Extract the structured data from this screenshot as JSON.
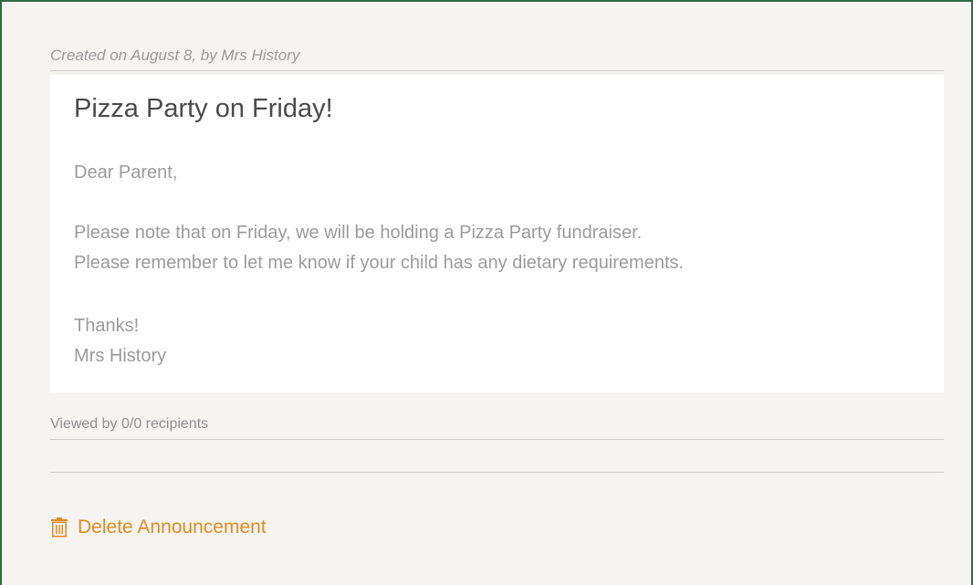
{
  "announcement": {
    "meta": "Created on August 8, by Mrs History",
    "title": "Pizza Party on Friday!",
    "body": {
      "greeting": "Dear Parent,",
      "line1": "Please note that on Friday, we will be holding a Pizza Party fundraiser.",
      "line2": "Please remember to let me know if your child has any dietary requirements.",
      "closing": "Thanks!",
      "signature": "Mrs History"
    },
    "viewed": "Viewed by 0/0 recipients"
  },
  "actions": {
    "delete_label": "Delete Announcement",
    "delete_icon": "trash-icon"
  },
  "colors": {
    "accent": "#e08a1e",
    "frame": "#2f6b45",
    "background": "#f5f4f1"
  }
}
